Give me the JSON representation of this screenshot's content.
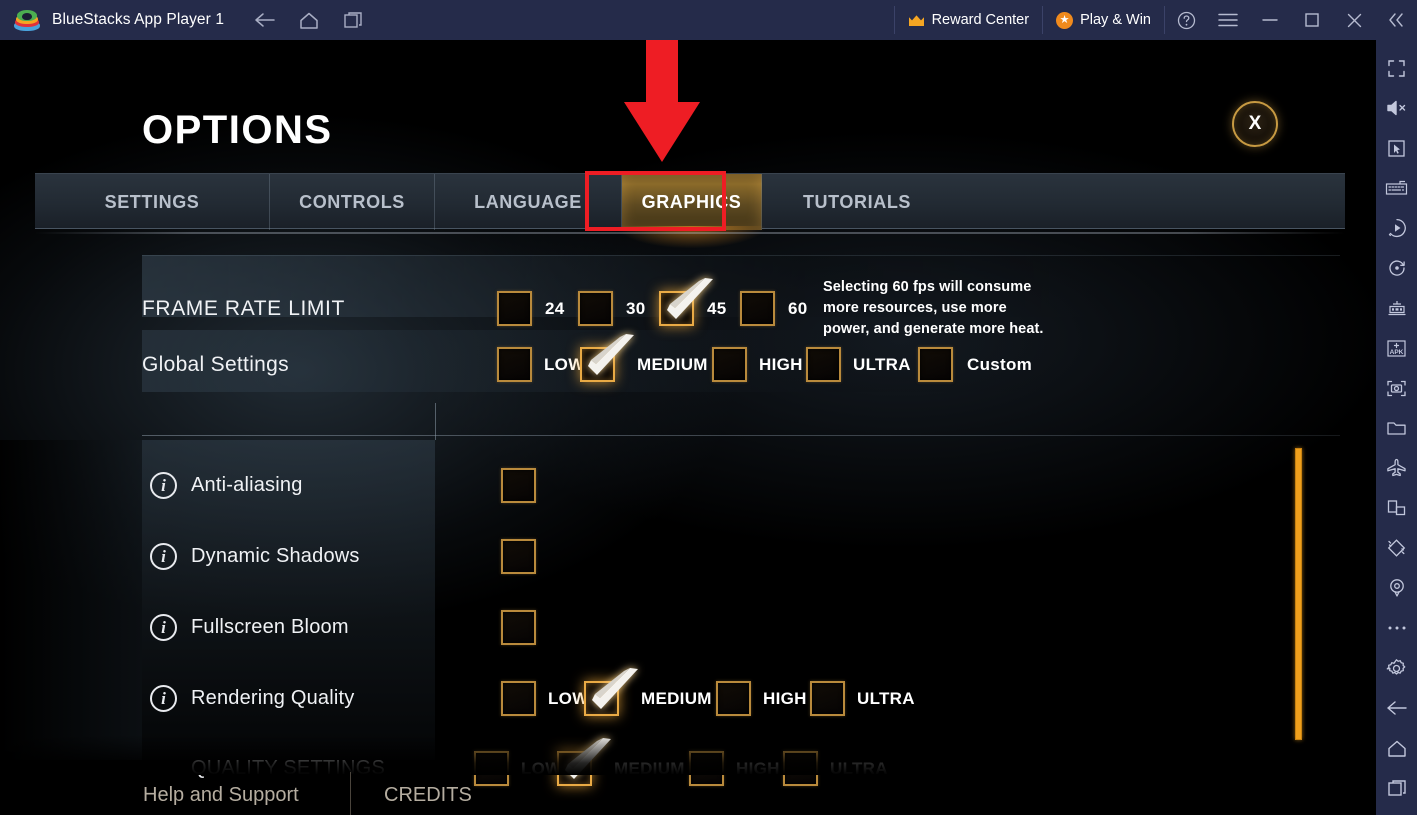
{
  "window": {
    "title": "BlueStacks App Player 1",
    "logo_icon": "bluestacks-logo-icon",
    "nav": [
      {
        "icon": "back-arrow-icon",
        "name": "nav-back"
      },
      {
        "icon": "home-icon",
        "name": "nav-home"
      },
      {
        "icon": "recents-icon",
        "name": "nav-recents"
      }
    ],
    "reward_center": {
      "label": "Reward Center",
      "icon": "crown-icon"
    },
    "play_and_win": {
      "label": "Play & Win",
      "icon": "star-badge-icon"
    },
    "controls": [
      {
        "icon": "help-circle-icon",
        "name": "help-button"
      },
      {
        "icon": "hamburger-menu-icon",
        "name": "menu-button"
      },
      {
        "icon": "minimize-icon",
        "name": "minimize-button"
      },
      {
        "icon": "maximize-icon",
        "name": "maximize-button"
      },
      {
        "icon": "close-icon",
        "name": "close-button"
      },
      {
        "icon": "collapse-chevrons-icon",
        "name": "collapse-sidebar-button"
      }
    ]
  },
  "sidebar": {
    "items": [
      {
        "icon": "fullscreen-icon",
        "name": "sidebar-fullscreen"
      },
      {
        "icon": "mute-icon",
        "name": "sidebar-mute"
      },
      {
        "icon": "cursor-icon",
        "name": "sidebar-game-controls"
      },
      {
        "icon": "keyboard-icon",
        "name": "sidebar-keyboard-controls"
      },
      {
        "icon": "macro-play-icon",
        "name": "sidebar-macro-recorder"
      },
      {
        "icon": "rotate-icon",
        "name": "sidebar-rotate"
      },
      {
        "icon": "multi-instance-icon",
        "name": "sidebar-multi-instance"
      },
      {
        "icon": "apk-install-icon",
        "name": "sidebar-install-apk"
      },
      {
        "icon": "screenshot-icon",
        "name": "sidebar-screenshot"
      },
      {
        "icon": "folder-icon",
        "name": "sidebar-media-manager"
      },
      {
        "icon": "airplane-icon",
        "name": "sidebar-eco-mode"
      },
      {
        "icon": "pip-icon",
        "name": "sidebar-picture-in-picture"
      },
      {
        "icon": "shake-icon",
        "name": "sidebar-shake"
      },
      {
        "icon": "location-pin-icon",
        "name": "sidebar-location"
      },
      {
        "icon": "more-dots-icon",
        "name": "sidebar-more"
      },
      {
        "icon": "gear-icon",
        "name": "sidebar-settings"
      },
      {
        "icon": "back-arrow-icon",
        "name": "sidebar-back"
      },
      {
        "icon": "home-icon",
        "name": "sidebar-home"
      },
      {
        "icon": "recents-icon",
        "name": "sidebar-recents"
      }
    ]
  },
  "options": {
    "title": "OPTIONS",
    "close_label": "X",
    "tabs": [
      {
        "label": "SETTINGS",
        "active": false
      },
      {
        "label": "CONTROLS",
        "active": false
      },
      {
        "label": "LANGUAGE",
        "active": false
      },
      {
        "label": "GRAPHICS",
        "active": true
      },
      {
        "label": "TUTORIALS",
        "active": false
      }
    ],
    "frame_rate": {
      "label": "FRAME RATE LIMIT",
      "choices": [
        {
          "label": "24",
          "checked": false
        },
        {
          "label": "30",
          "checked": false
        },
        {
          "label": "45",
          "checked": true
        },
        {
          "label": "60",
          "checked": false
        }
      ],
      "hint": "Selecting 60 fps will consume more resources, use more power, and generate more heat."
    },
    "global_settings": {
      "label": "Global Settings",
      "choices": [
        {
          "label": "LOW",
          "checked": false
        },
        {
          "label": "MEDIUM",
          "checked": true
        },
        {
          "label": "HIGH",
          "checked": false
        },
        {
          "label": "ULTRA",
          "checked": false
        },
        {
          "label": "Custom",
          "checked": false
        }
      ]
    },
    "items": [
      {
        "label": "Anti-aliasing",
        "info_icon": "info-icon",
        "choices": [
          {
            "label": "",
            "checked": false
          }
        ]
      },
      {
        "label": "Dynamic Shadows",
        "info_icon": "info-icon",
        "choices": [
          {
            "label": "",
            "checked": false
          }
        ]
      },
      {
        "label": "Fullscreen Bloom",
        "info_icon": "info-icon",
        "choices": [
          {
            "label": "",
            "checked": false
          }
        ]
      },
      {
        "label": "Rendering Quality",
        "info_icon": "info-icon",
        "choices": [
          {
            "label": "LOW",
            "checked": false
          },
          {
            "label": "MEDIUM",
            "checked": true
          },
          {
            "label": "HIGH",
            "checked": false
          },
          {
            "label": "ULTRA",
            "checked": false
          }
        ]
      },
      {
        "label": "QUALITY SETTINGS",
        "info_icon": "",
        "choices": [
          {
            "label": "LOW",
            "checked": false
          },
          {
            "label": "MEDIUM",
            "checked": true
          },
          {
            "label": "HIGH",
            "checked": false
          },
          {
            "label": "ULTRA",
            "checked": false
          }
        ]
      }
    ],
    "footer": {
      "help": "Help and Support",
      "credits": "CREDITS"
    }
  },
  "annotation": {
    "arrow_color": "#ee1d24",
    "highlight_target": "GRAPHICS"
  },
  "colors": {
    "accent_gold": "#e9aa45",
    "scrollbar": "#f0a01c",
    "topbar": "#252b4a",
    "annotation_red": "#ee1d24"
  }
}
